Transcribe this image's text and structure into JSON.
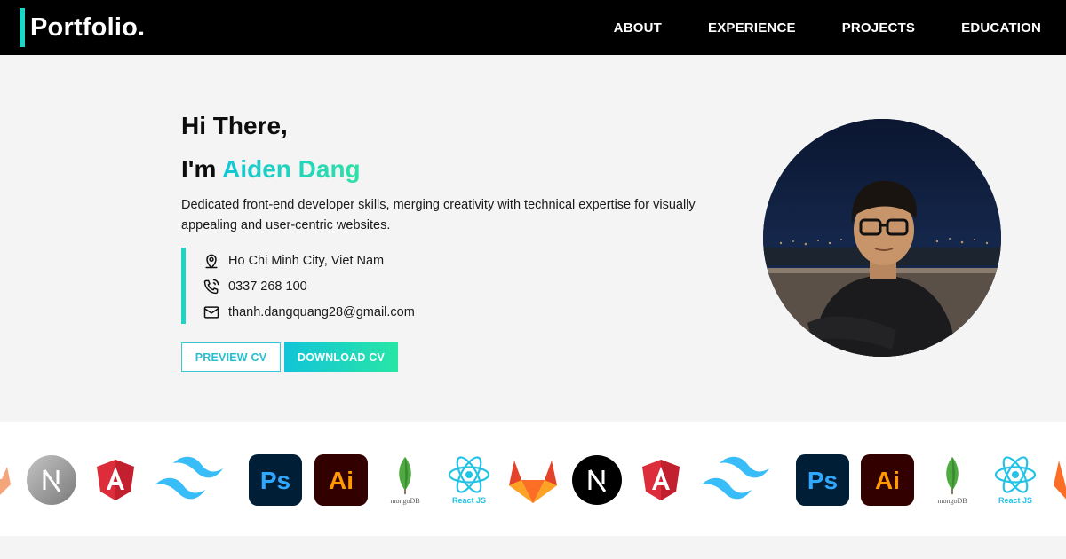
{
  "header": {
    "logo": "Portfolio.",
    "nav": [
      "ABOUT",
      "EXPERIENCE",
      "PROJECTS",
      "EDUCATION"
    ]
  },
  "hero": {
    "greeting": "Hi There,",
    "intro_prefix": "I'm",
    "name": "Aiden Dang",
    "description": "Dedicated front-end developer skills, merging creativity with technical expertise for visually appealing and user-centric websites.",
    "contacts": {
      "location": "Ho Chi Minh City, Viet Nam",
      "phone": "0337 268 100",
      "email": "thanh.dangquang28@gmail.com"
    },
    "buttons": {
      "preview": "PREVIEW CV",
      "download": "DOWNLOAD CV"
    }
  },
  "tech_strip": {
    "ps_label": "Ps",
    "ai_label": "Ai",
    "mongo_label": "mongoDB",
    "react_label": "React JS",
    "icons": [
      "gitlab-icon",
      "nextjs-icon",
      "angular-icon",
      "tailwind-icon",
      "photoshop-icon",
      "illustrator-icon",
      "mongodb-icon",
      "react-icon"
    ]
  },
  "colors": {
    "accent": "#1ed6c6",
    "gradient_start": "#12c4d8",
    "gradient_end": "#27e6a6",
    "header_bg": "#000000"
  }
}
